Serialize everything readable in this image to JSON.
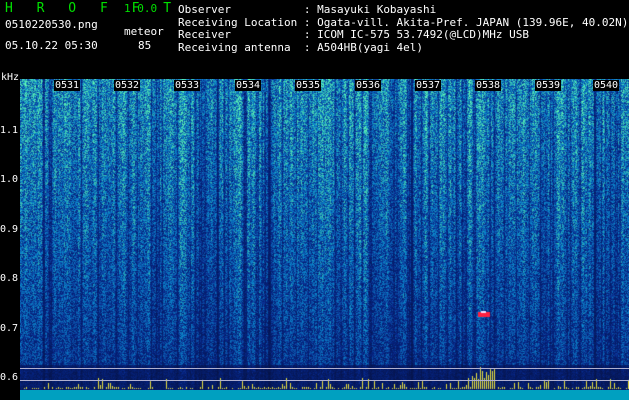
{
  "header": {
    "app_title": "H R O F F T",
    "version": "1.0.0",
    "file_name": "0510220530.png",
    "datetime": "05.10.22 05:30",
    "meteor_label": "meteor",
    "meteor_count": "85"
  },
  "station": [
    {
      "key": "Observer          ",
      "value": ": Masayuki Kobayashi"
    },
    {
      "key": "Receiving Location",
      "value": ": Ogata-vill. Akita-Pref. JAPAN (139.96E, 40.02N)"
    },
    {
      "key": "Receiver          ",
      "value": ": ICOM IC-575 53.7492(@LCD)MHz USB"
    },
    {
      "key": "Receiving antenna ",
      "value": ": A504HB(yagi 4el)"
    }
  ],
  "axis": {
    "unit": "kHz",
    "y_labels": [
      "1.1",
      "1.0",
      "0.9",
      "0.8",
      "0.7",
      "0.6"
    ],
    "time_labels": [
      "0531",
      "0532",
      "0533",
      "0534",
      "0535",
      "0536",
      "0537",
      "0538",
      "0539",
      "0540"
    ]
  },
  "colors": {
    "background": "#000000",
    "title": "#00e000",
    "spectrum_low": "#0a1a6a",
    "spectrum_high": "#30e0a0",
    "meteor_echo": "#ff2040",
    "baseline": "#00a0c0"
  }
}
